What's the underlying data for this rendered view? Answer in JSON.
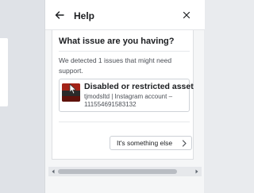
{
  "help_panel": {
    "title": "Help",
    "back_icon": "arrow-left-icon",
    "close_icon": "close-icon"
  },
  "card": {
    "question": "What issue are you having?",
    "description": "We detected 1 issues that might need support.",
    "issue": {
      "title": "Disabled or restricted asset",
      "subtitle": "tjmodsltd | Instagram account – 111554691583132",
      "thumbnail_icon": "asset-thumbnail"
    },
    "else_button": {
      "label": "It's something else",
      "icon": "chevron-right-icon"
    }
  },
  "scrollbar": {
    "left_icon": "scroll-left-arrow-icon",
    "right_icon": "scroll-right-arrow-icon"
  },
  "colors": {
    "panel_bg": "#f5f6f7",
    "card_bg": "#ffffff",
    "text": "#1c1e21",
    "muted_text": "#4b4f56",
    "border": "#dddfe2"
  }
}
